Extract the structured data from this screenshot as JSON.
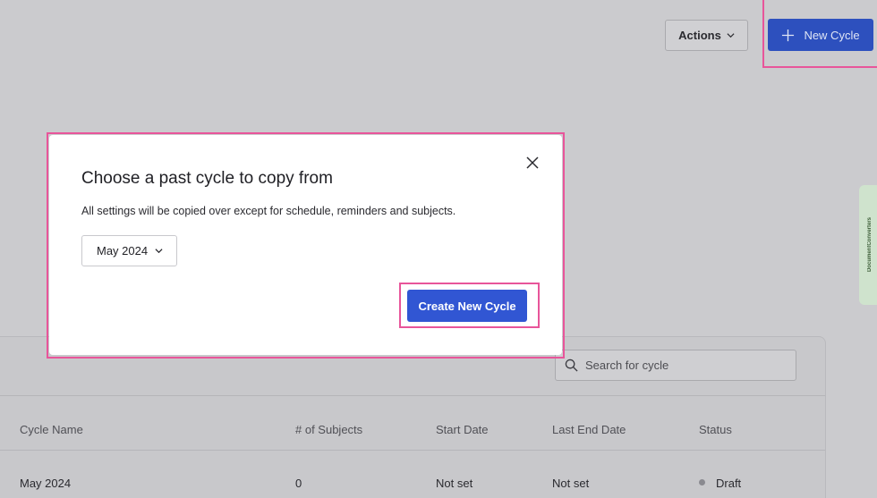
{
  "header": {
    "actions_label": "Actions",
    "new_cycle_label": "New Cycle"
  },
  "extension": {
    "label": "DocumentConverters"
  },
  "modal": {
    "title": "Choose a past cycle to copy from",
    "description": "All settings will be copied over except for schedule, reminders and subjects.",
    "selected_cycle": "May 2024",
    "create_label": "Create New Cycle"
  },
  "table": {
    "search_placeholder": "Search for cycle",
    "columns": [
      "Cycle Name",
      "# of Subjects",
      "Start Date",
      "Last End Date",
      "Status"
    ],
    "rows": [
      {
        "name": "May 2024",
        "subjects": "0",
        "start": "Not set",
        "end": "Not set",
        "status": "Draft"
      }
    ]
  },
  "colors": {
    "primary": "#3156d3",
    "highlight": "#e8559a",
    "overlay": "#cbcbce"
  }
}
